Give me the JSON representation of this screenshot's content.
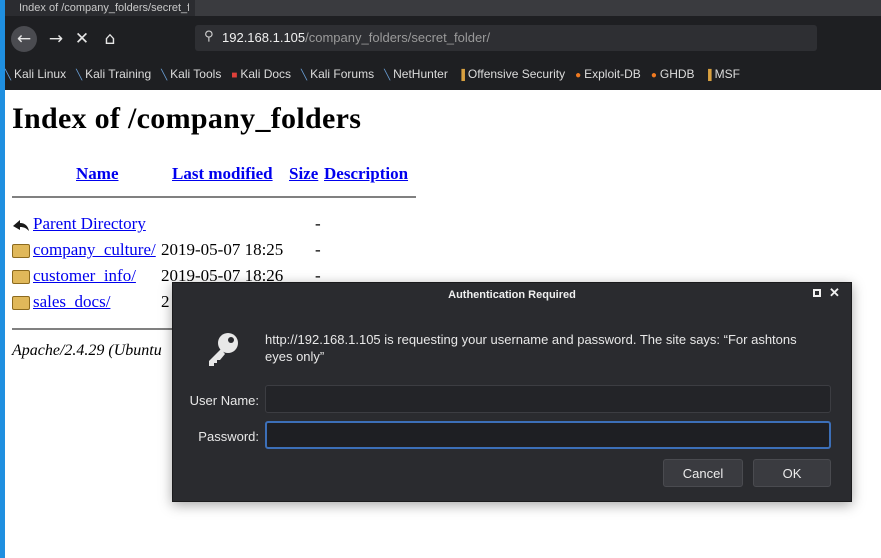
{
  "browser": {
    "tab_title": "Index of /company_folders/secret_folder",
    "url_host": "192.168.1.105",
    "url_path": "/company_folders/secret_folder/",
    "bookmarks": [
      {
        "label": "Kali Linux",
        "icon": "kali-dragon-icon"
      },
      {
        "label": "Kali Training",
        "icon": "kali-dragon-icon"
      },
      {
        "label": "Kali Tools",
        "icon": "kali-dragon-icon"
      },
      {
        "label": "Kali Docs",
        "icon": "kali-docs-icon"
      },
      {
        "label": "Kali Forums",
        "icon": "kali-dragon-icon"
      },
      {
        "label": "NetHunter",
        "icon": "kali-dragon-icon"
      },
      {
        "label": "Offensive Security",
        "icon": "offsec-icon"
      },
      {
        "label": "Exploit-DB",
        "icon": "exploit-db-icon"
      },
      {
        "label": "GHDB",
        "icon": "ghdb-icon"
      },
      {
        "label": "MSF",
        "icon": "offsec-icon"
      }
    ]
  },
  "page": {
    "heading": "Index of /company_folders",
    "columns": {
      "name": "Name",
      "modified": "Last modified",
      "size": "Size",
      "description": "Description"
    },
    "rows": [
      {
        "name": "Parent Directory",
        "modified": "",
        "size": "-",
        "icon": "back-arrow-icon"
      },
      {
        "name": "company_culture/",
        "modified": "2019-05-07 18:25",
        "size": "-",
        "icon": "folder-icon"
      },
      {
        "name": "customer_info/",
        "modified": "2019-05-07 18:26",
        "size": "-",
        "icon": "folder-icon"
      },
      {
        "name": "sales_docs/",
        "modified": "2",
        "size": "",
        "icon": "folder-icon"
      }
    ],
    "footer": "Apache/2.4.29 (Ubuntu"
  },
  "dialog": {
    "title": "Authentication Required",
    "message": "http://192.168.1.105 is requesting your username and password. The site says: “For ashtons eyes only”",
    "username_label": "User Name:",
    "username_value": "",
    "password_label": "Password:",
    "password_value": "",
    "cancel_label": "Cancel",
    "ok_label": "OK"
  },
  "colors": {
    "link": "#0000ee",
    "dialog_bg": "#2a2b2f",
    "focus_ring": "#3c6fb8",
    "toolbar_bg": "#1e1f22"
  }
}
